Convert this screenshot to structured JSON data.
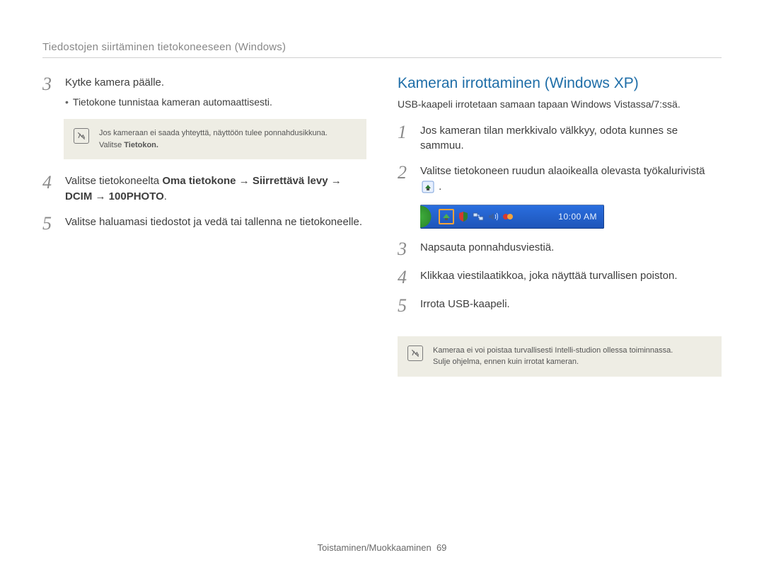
{
  "breadcrumb": "Tiedostojen siirtäminen tietokoneeseen (Windows)",
  "left": {
    "steps": {
      "s3": {
        "num": "3",
        "text": "Kytke kamera päälle.",
        "bullet": "Tietokone tunnistaa kameran automaattisesti."
      },
      "note": {
        "line1": "Jos kameraan ei saada yhteyttä, näyttöön tulee ponnahdusikkuna.",
        "line2_pre": "Valitse ",
        "line2_bold": "Tietokon."
      },
      "s4": {
        "num": "4",
        "pre": "Valitse tietokoneelta ",
        "bold1": "Oma tietokone",
        "arr1": " → ",
        "bold2": "Siirrettävä levy",
        "arr2": " → ",
        "bold3": "DCIM",
        "arr3": " → ",
        "bold4": "100PHOTO",
        "post": "."
      },
      "s5": {
        "num": "5",
        "text": "Valitse haluamasi tiedostot ja vedä tai tallenna ne tietokoneelle."
      }
    }
  },
  "right": {
    "heading": "Kameran irrottaminen (Windows XP)",
    "sub": "USB-kaapeli irrotetaan samaan tapaan Windows Vistassa/7:ssä.",
    "s1": {
      "num": "1",
      "text": "Jos kameran tilan merkkivalo välkkyy, odota kunnes se sammuu."
    },
    "s2": {
      "num": "2",
      "text_pre": "Valitse tietokoneen ruudun alaoikealla olevasta työkalurivistä ",
      "text_post": "."
    },
    "taskbar": {
      "clock": "10:00 AM"
    },
    "s3": {
      "num": "3",
      "text": "Napsauta ponnahdusviestiä."
    },
    "s4": {
      "num": "4",
      "text": "Klikkaa viestilaatikkoa, joka näyttää turvallisen poiston."
    },
    "s5": {
      "num": "5",
      "text": "Irrota USB-kaapeli."
    },
    "note": {
      "line1": "Kameraa ei voi poistaa turvallisesti Intelli-studion ollessa toiminnassa.",
      "line2": "Sulje ohjelma, ennen kuin irrotat kameran."
    }
  },
  "footer": {
    "section": "Toistaminen/Muokkaaminen",
    "page": "69"
  }
}
